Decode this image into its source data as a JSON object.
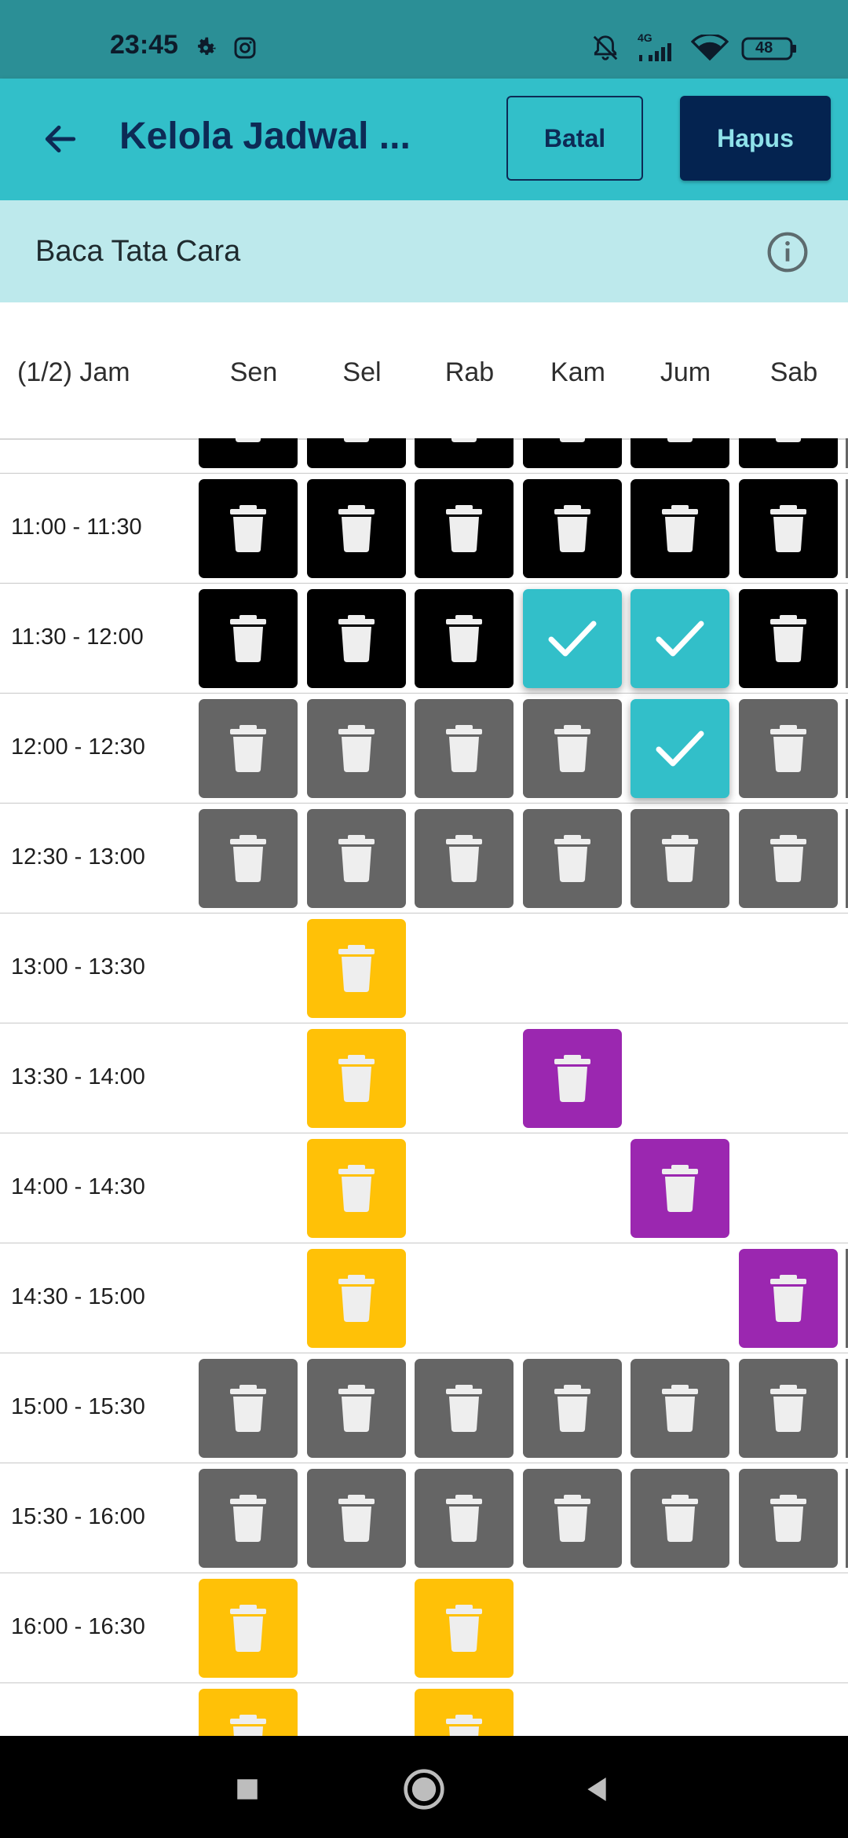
{
  "status_bar": {
    "time": "23:45",
    "network": "4G",
    "battery": "48",
    "icons": [
      "settings-icon",
      "instagram-icon",
      "mute-bell-icon",
      "signal-icon",
      "wifi-icon",
      "battery-icon"
    ]
  },
  "app_bar": {
    "title": "Kelola Jadwal ...",
    "cancel_label": "Batal",
    "delete_label": "Hapus"
  },
  "info": {
    "text": "Baca Tata Cara"
  },
  "grid": {
    "hour_header": "(1/2) Jam",
    "days": [
      "Sen",
      "Sel",
      "Rab",
      "Kam",
      "Jum",
      "Sab"
    ],
    "rows": [
      {
        "time": "",
        "cells": [
          "black",
          "black",
          "black",
          "black",
          "black",
          "black"
        ]
      },
      {
        "time": "11:00 - 11:30",
        "cells": [
          "black",
          "black",
          "black",
          "black",
          "black",
          "black"
        ]
      },
      {
        "time": "11:30 - 12:00",
        "cells": [
          "black",
          "black",
          "black",
          "teal",
          "teal",
          "black"
        ]
      },
      {
        "time": "12:00 - 12:30",
        "cells": [
          "gray",
          "gray",
          "gray",
          "gray",
          "teal",
          "gray"
        ]
      },
      {
        "time": "12:30 - 13:00",
        "cells": [
          "gray",
          "gray",
          "gray",
          "gray",
          "gray",
          "gray"
        ]
      },
      {
        "time": "13:00 - 13:30",
        "cells": [
          "",
          "yellow",
          "",
          "",
          "",
          ""
        ]
      },
      {
        "time": "13:30 - 14:00",
        "cells": [
          "",
          "yellow",
          "",
          "purple",
          "",
          ""
        ]
      },
      {
        "time": "14:00 - 14:30",
        "cells": [
          "",
          "yellow",
          "",
          "",
          "purple",
          ""
        ]
      },
      {
        "time": "14:30 - 15:00",
        "cells": [
          "",
          "yellow",
          "",
          "",
          "",
          "purple"
        ]
      },
      {
        "time": "15:00 - 15:30",
        "cells": [
          "gray",
          "gray",
          "gray",
          "gray",
          "gray",
          "gray"
        ]
      },
      {
        "time": "15:30 - 16:00",
        "cells": [
          "gray",
          "gray",
          "gray",
          "gray",
          "gray",
          "gray"
        ]
      },
      {
        "time": "16:00 - 16:30",
        "cells": [
          "yellow",
          "",
          "yellow",
          "",
          "",
          ""
        ]
      },
      {
        "time": "",
        "cells": [
          "yellow",
          "",
          "yellow",
          "",
          "",
          ""
        ]
      }
    ]
  },
  "colors": {
    "black": "#000000",
    "gray": "#656565",
    "yellow": "#ffc107",
    "purple": "#9b27b0",
    "teal": "#32bfc9",
    "header": "#32bfc9",
    "banner": "#bde9ec",
    "accent_dark": "#042350"
  },
  "nav_bar": {
    "icons": [
      "recents-icon",
      "home-icon",
      "back-icon"
    ]
  }
}
